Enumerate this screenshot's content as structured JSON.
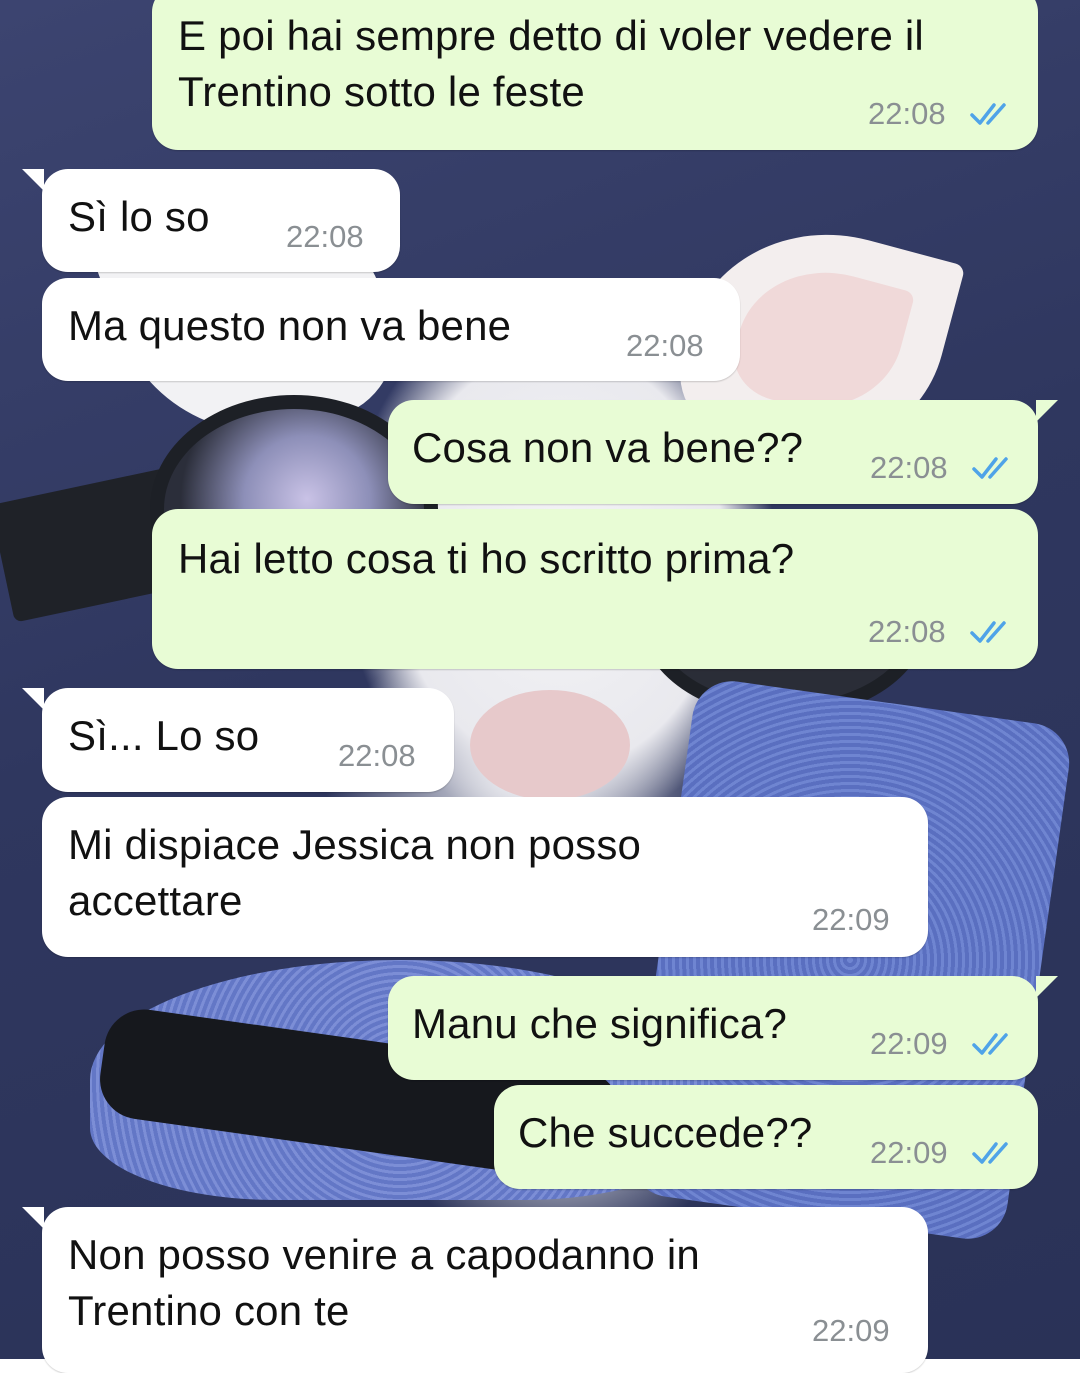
{
  "messages": [
    {
      "direction": "out",
      "text": "E poi hai sempre detto di voler vedere il\nTrentino sotto le feste",
      "time": "22:08",
      "status_icon": "double-check-read-icon"
    },
    {
      "direction": "in",
      "text": "Sì lo so",
      "time": "22:08"
    },
    {
      "direction": "in",
      "text": "Ma questo non va bene",
      "time": "22:08"
    },
    {
      "direction": "out",
      "text": "Cosa non va bene??",
      "time": "22:08",
      "status_icon": "double-check-read-icon"
    },
    {
      "direction": "out",
      "text": "Hai letto cosa ti ho scritto prima?",
      "time": "22:08",
      "status_icon": "double-check-read-icon"
    },
    {
      "direction": "in",
      "text": "Sì... Lo so",
      "time": "22:08"
    },
    {
      "direction": "in",
      "text": "Mi dispiace Jessica non posso\naccettare",
      "time": "22:09"
    },
    {
      "direction": "out",
      "text": "Manu che significa?",
      "time": "22:09",
      "status_icon": "double-check-read-icon"
    },
    {
      "direction": "out",
      "text": "Che succede??",
      "time": "22:09",
      "status_icon": "double-check-read-icon"
    },
    {
      "direction": "in",
      "text": "Non posso venire a capodanno in\nTrentino con te",
      "time": "22:09"
    }
  ],
  "colors": {
    "incoming_bubble": "#ffffff",
    "outgoing_bubble": "#e8fcd5",
    "read_ticks": "#4fa3e8",
    "timestamp": "#8a8f93",
    "wallpaper": "#2f375f"
  }
}
